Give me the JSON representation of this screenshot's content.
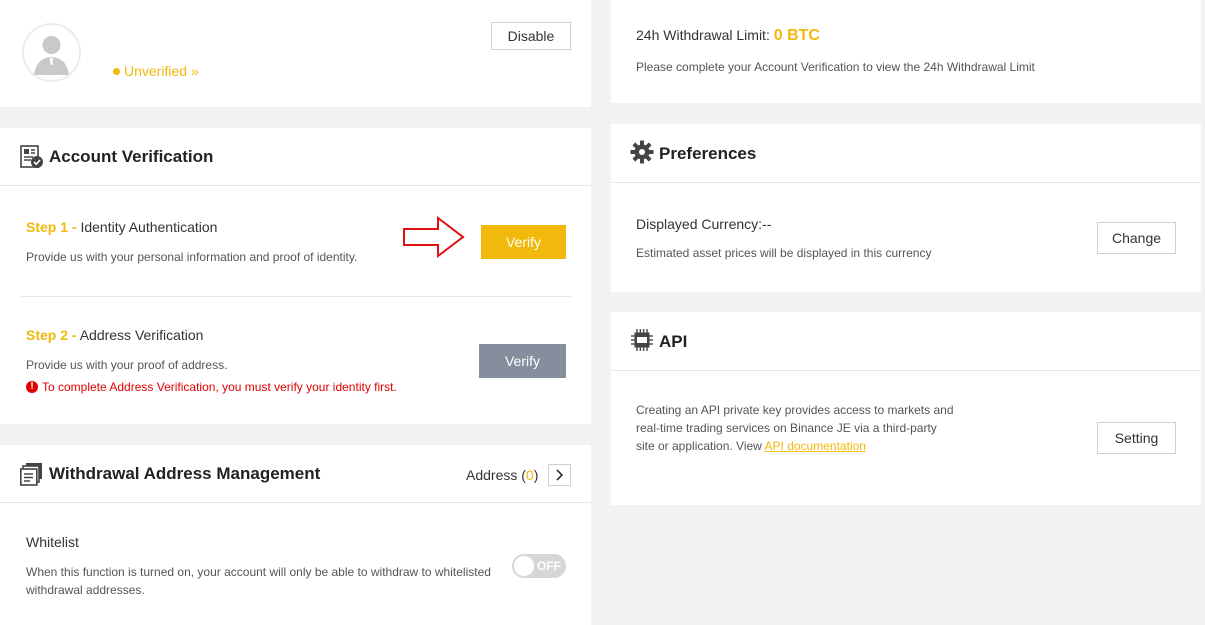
{
  "profile": {
    "disable_label": "Disable",
    "status": "Unverified »"
  },
  "withdrawal_limit": {
    "label": "24h Withdrawal Limit:",
    "value": "0 BTC",
    "note": "Please complete your Account Verification to view the 24h Withdrawal Limit"
  },
  "account_verification": {
    "title": "Account Verification",
    "step1": {
      "prefix": "Step 1 -",
      "name": "Identity Authentication",
      "desc": "Provide us with your personal information and proof of identity.",
      "button": "Verify"
    },
    "step2": {
      "prefix": "Step 2 -",
      "name": "Address Verification",
      "desc": "Provide us with your proof of address.",
      "warning": "To complete Address Verification, you must verify your identity first.",
      "button": "Verify"
    }
  },
  "preferences": {
    "title": "Preferences",
    "currency_label": "Displayed Currency:--",
    "currency_note": "Estimated asset prices will be displayed in this currency",
    "button": "Change"
  },
  "api": {
    "title": "API",
    "desc_line1": "Creating an API private key provides access to markets and",
    "desc_line2": "real-time trading services on Binance JE via a third-party",
    "desc_line3": "site or application. View",
    "link": "API documentation",
    "button": "Setting"
  },
  "withdrawal_address": {
    "title": "Withdrawal Address Management",
    "address_label": "Address (",
    "address_count": "0",
    "address_close": ")",
    "whitelist_title": "Whitelist",
    "whitelist_line1": "When this function is turned on, your account will only be able to withdraw to whitelisted",
    "whitelist_line2": "withdrawal addresses.",
    "toggle_label": "OFF"
  },
  "colors": {
    "accent": "#f0b90b",
    "error": "#e00000",
    "disabled_button": "#848e9c",
    "arrow": "#e01010"
  }
}
